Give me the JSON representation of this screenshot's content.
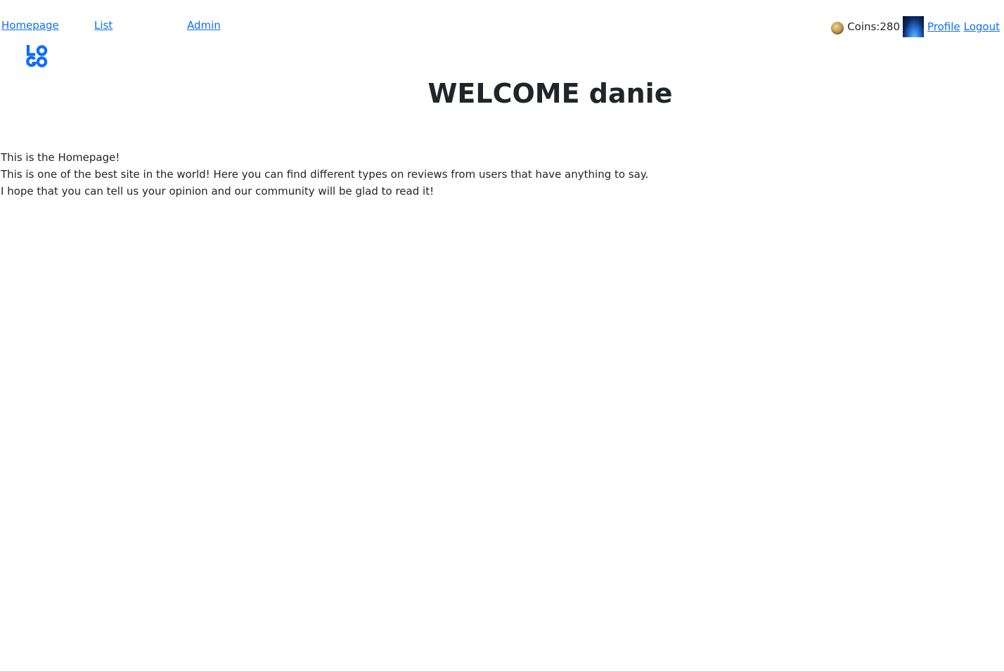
{
  "nav": {
    "homepage": "Homepage",
    "list": "List",
    "admin": "Admin"
  },
  "user_bar": {
    "coins_label": "Coins:280",
    "profile": "Profile",
    "logout": "Logout",
    "coin_icon": "coin-icon",
    "avatar_icon": "avatar-image"
  },
  "logo": {
    "text_top": "LO",
    "text_bottom": "GO",
    "color": "#0d6efd"
  },
  "main": {
    "title": "WELCOME danie",
    "lines": [
      "This is the Homepage!",
      "This is one of the best site in the world! Here you can find different types on reviews from users that have anything to say.",
      "I hope that you can tell us your opinion and our community will be glad to read it!"
    ]
  },
  "colors": {
    "link": "#0d6efd",
    "text": "#212529",
    "background": "#ffffff"
  }
}
